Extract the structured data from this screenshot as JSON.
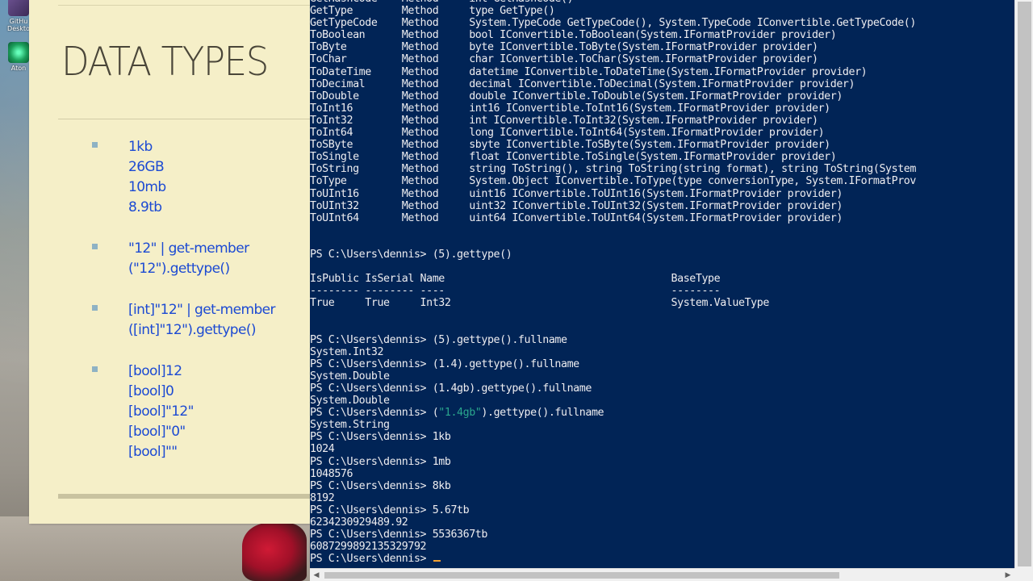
{
  "desktop": {
    "icons": [
      {
        "label": "GitHu Deskto",
        "icon": "github-desktop-icon"
      },
      {
        "label": "Aton",
        "icon": "atom-icon"
      }
    ]
  },
  "slide": {
    "title": "DATA TYPES",
    "bullet_groups": [
      {
        "lines": [
          "1kb",
          "26GB",
          "10mb",
          "8.9tb"
        ]
      },
      {
        "lines": [
          "\"12\" | get-member",
          "(\"12\").gettype()"
        ]
      },
      {
        "lines": [
          "[int]\"12\" | get-member",
          "([int]\"12\").gettype()"
        ]
      },
      {
        "lines": [
          "[bool]12",
          "[bool]0",
          "[bool]\"12\"",
          "[bool]\"0\"",
          "[bool]\"\""
        ]
      }
    ],
    "colors": {
      "background": "#f5efc8",
      "title": "#4a4639",
      "bullet_text": "#1c4ad3",
      "bullet_marker": "#8eb2c4"
    }
  },
  "console": {
    "colors": {
      "background": "#012456",
      "text": "#eeedf0",
      "string_literal": "#2aa68d",
      "cursor": "#f0a030"
    },
    "lines": [
      "GetHashCode    Method     int GetHashCode()",
      "GetType        Method     type GetType()",
      "GetTypeCode    Method     System.TypeCode GetTypeCode(), System.TypeCode IConvertible.GetTypeCode()",
      "ToBoolean      Method     bool IConvertible.ToBoolean(System.IFormatProvider provider)",
      "ToByte         Method     byte IConvertible.ToByte(System.IFormatProvider provider)",
      "ToChar         Method     char IConvertible.ToChar(System.IFormatProvider provider)",
      "ToDateTime     Method     datetime IConvertible.ToDateTime(System.IFormatProvider provider)",
      "ToDecimal      Method     decimal IConvertible.ToDecimal(System.IFormatProvider provider)",
      "ToDouble       Method     double IConvertible.ToDouble(System.IFormatProvider provider)",
      "ToInt16        Method     int16 IConvertible.ToInt16(System.IFormatProvider provider)",
      "ToInt32        Method     int IConvertible.ToInt32(System.IFormatProvider provider)",
      "ToInt64        Method     long IConvertible.ToInt64(System.IFormatProvider provider)",
      "ToSByte        Method     sbyte IConvertible.ToSByte(System.IFormatProvider provider)",
      "ToSingle       Method     float IConvertible.ToSingle(System.IFormatProvider provider)",
      "ToString       Method     string ToString(), string ToString(string format), string ToString(System",
      "ToType         Method     System.Object IConvertible.ToType(type conversionType, System.IFormatProv",
      "ToUInt16       Method     uint16 IConvertible.ToUInt16(System.IFormatProvider provider)",
      "ToUInt32       Method     uint32 IConvertible.ToUInt32(System.IFormatProvider provider)",
      "ToUInt64       Method     uint64 IConvertible.ToUInt64(System.IFormatProvider provider)",
      "",
      "",
      "PS C:\\Users\\dennis> (5).gettype()",
      "",
      "IsPublic IsSerial Name                                     BaseType",
      "-------- -------- ----                                     --------",
      "True     True     Int32                                    System.ValueType",
      "",
      "",
      "PS C:\\Users\\dennis> (5).gettype().fullname",
      "System.Int32",
      "PS C:\\Users\\dennis> (1.4).gettype().fullname",
      "System.Double",
      "PS C:\\Users\\dennis> (1.4gb).gettype().fullname",
      "System.Double",
      {
        "segments": [
          "PS C:\\Users\\dennis> (",
          "\"1.4gb\"",
          ").gettype().fullname"
        ]
      },
      "System.String",
      "PS C:\\Users\\dennis> 1kb",
      "1024",
      "PS C:\\Users\\dennis> 1mb",
      "1048576",
      "PS C:\\Users\\dennis> 8kb",
      "8192",
      "PS C:\\Users\\dennis> 5.67tb",
      "6234230929489.92",
      "PS C:\\Users\\dennis> 5536367tb",
      "6087299892135329792",
      {
        "prompt": "PS C:\\Users\\dennis> "
      }
    ]
  },
  "scrollbars": {
    "left_arrow": "◀",
    "right_arrow": "▶"
  }
}
